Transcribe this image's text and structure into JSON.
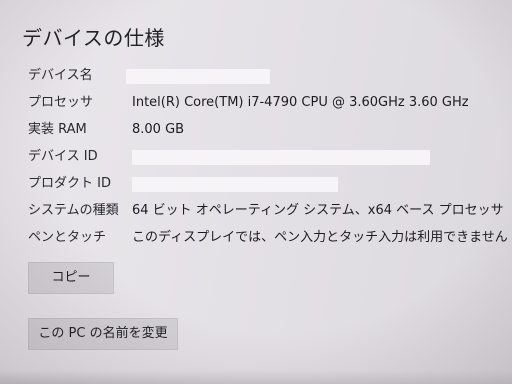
{
  "page": {
    "title": "デバイスの仕様"
  },
  "specs": [
    {
      "label": "デバイス名",
      "value": ""
    },
    {
      "label": "プロセッサ",
      "value": "Intel(R) Core(TM) i7-4790 CPU @ 3.60GHz   3.60 GHz"
    },
    {
      "label": "実装 RAM",
      "value": "8.00 GB"
    },
    {
      "label": "デバイス ID",
      "value": ""
    },
    {
      "label": "プロダクト ID",
      "value": ""
    },
    {
      "label": "システムの種類",
      "value": "64 ビット オペレーティング システム、x64 ベース プロセッサ"
    },
    {
      "label": "ペンとタッチ",
      "value": "このディスプレイでは、ペン入力とタッチ入力は利用できません"
    }
  ],
  "buttons": {
    "copy_label": "コピー",
    "rename_label": "この PC の名前を変更"
  }
}
